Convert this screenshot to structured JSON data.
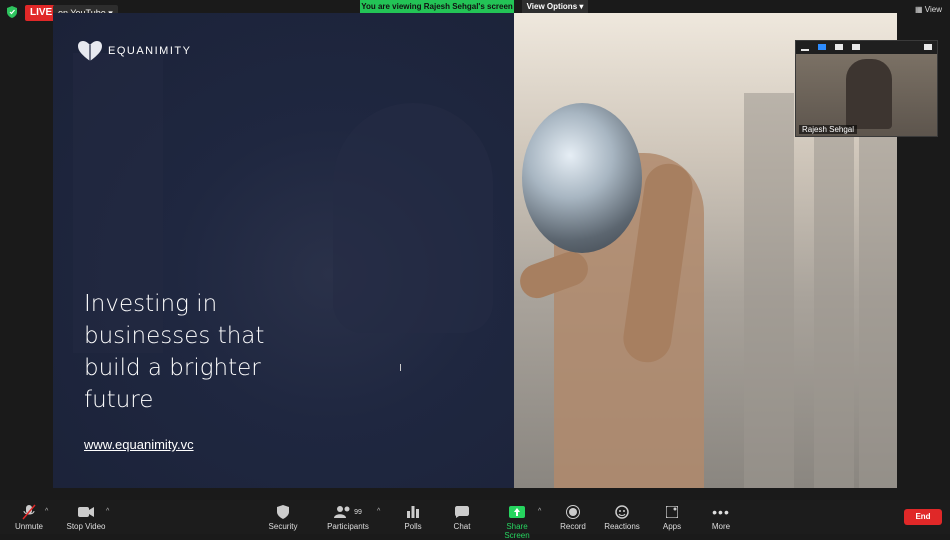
{
  "topbar": {
    "live_label": "LIVE",
    "live_destination": "on YouTube",
    "viewing_banner": "You are viewing Rajesh Sehgal's screen",
    "view_options": "View Options",
    "view": "View"
  },
  "slide": {
    "logo_text": "EQUANIMITY",
    "headline": "Investing in businesses that build a brighter future",
    "url": "www.equanimity.vc"
  },
  "pip": {
    "participant_name": "Rajesh Sehgal"
  },
  "toolbar": {
    "unmute": "Unmute",
    "stop_video": "Stop Video",
    "security": "Security",
    "participants": "Participants",
    "participants_count": "99",
    "polls": "Polls",
    "chat": "Chat",
    "share_screen": "Share Screen",
    "record": "Record",
    "reactions": "Reactions",
    "apps": "Apps",
    "more": "More",
    "end": "End"
  },
  "colors": {
    "live_red": "#e02828",
    "banner_green": "#23c356",
    "slide_navy": "#1f2740"
  }
}
